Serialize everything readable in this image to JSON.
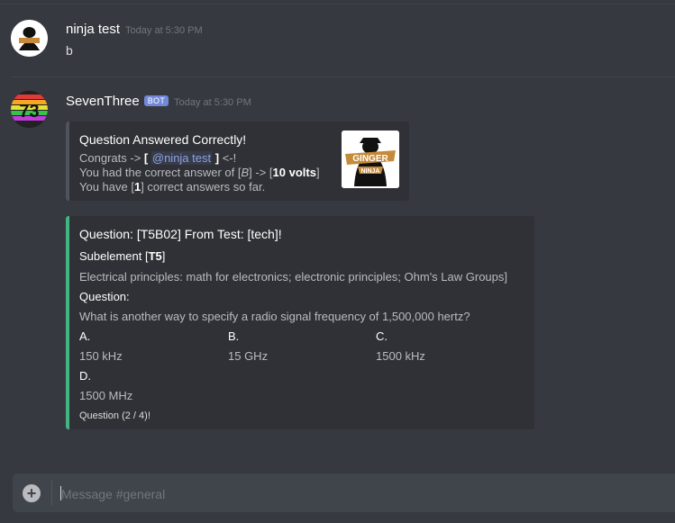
{
  "messages": [
    {
      "username": "ninja test",
      "timestamp": "Today at 5:30 PM",
      "text": "b"
    },
    {
      "username": "SevenThree",
      "bot_tag": "BOT",
      "timestamp": "Today at 5:30 PM"
    }
  ],
  "embed_answer": {
    "title": "Question Answered Correctly!",
    "line1_prefix": "Congrats -> ",
    "line1_bracket_open": "[",
    "line1_mention": "@ninja test",
    "line1_bracket_close": "]",
    "line1_suffix": " <-!",
    "line2_prefix": "You had the correct answer of [",
    "line2_answer": "B",
    "line2_mid": "] -> [",
    "line2_value": "10 volts",
    "line2_suffix": "]",
    "line3_prefix": "You have [",
    "line3_count": "1",
    "line3_suffix": "] correct answers so far.",
    "thumbnail_label_top": "GINGER",
    "thumbnail_label_bottom": "NINJA",
    "accent_color": "#4f545c"
  },
  "embed_question": {
    "title": "Question: [T5B02] From Test: [tech]!",
    "subelement_label": "Subelement [",
    "subelement_code": "T5",
    "subelement_close": "]",
    "subelement_desc": "Electrical principles: math for electronics; electronic principles; Ohm's Law Groups]",
    "question_label": "Question:",
    "question_text": "What is another way to specify a radio signal frequency of 1,500,000 hertz?",
    "options": [
      {
        "label": "A.",
        "value": "150 kHz"
      },
      {
        "label": "B.",
        "value": "15 GHz"
      },
      {
        "label": "C.",
        "value": "1500 kHz"
      },
      {
        "label": "D.",
        "value": "1500 MHz"
      }
    ],
    "footer": "Question (2 / 4)!",
    "accent_color": "#43b581"
  },
  "composer": {
    "placeholder": "Message #general"
  },
  "icons": {
    "upload": "plus-circle-icon"
  }
}
